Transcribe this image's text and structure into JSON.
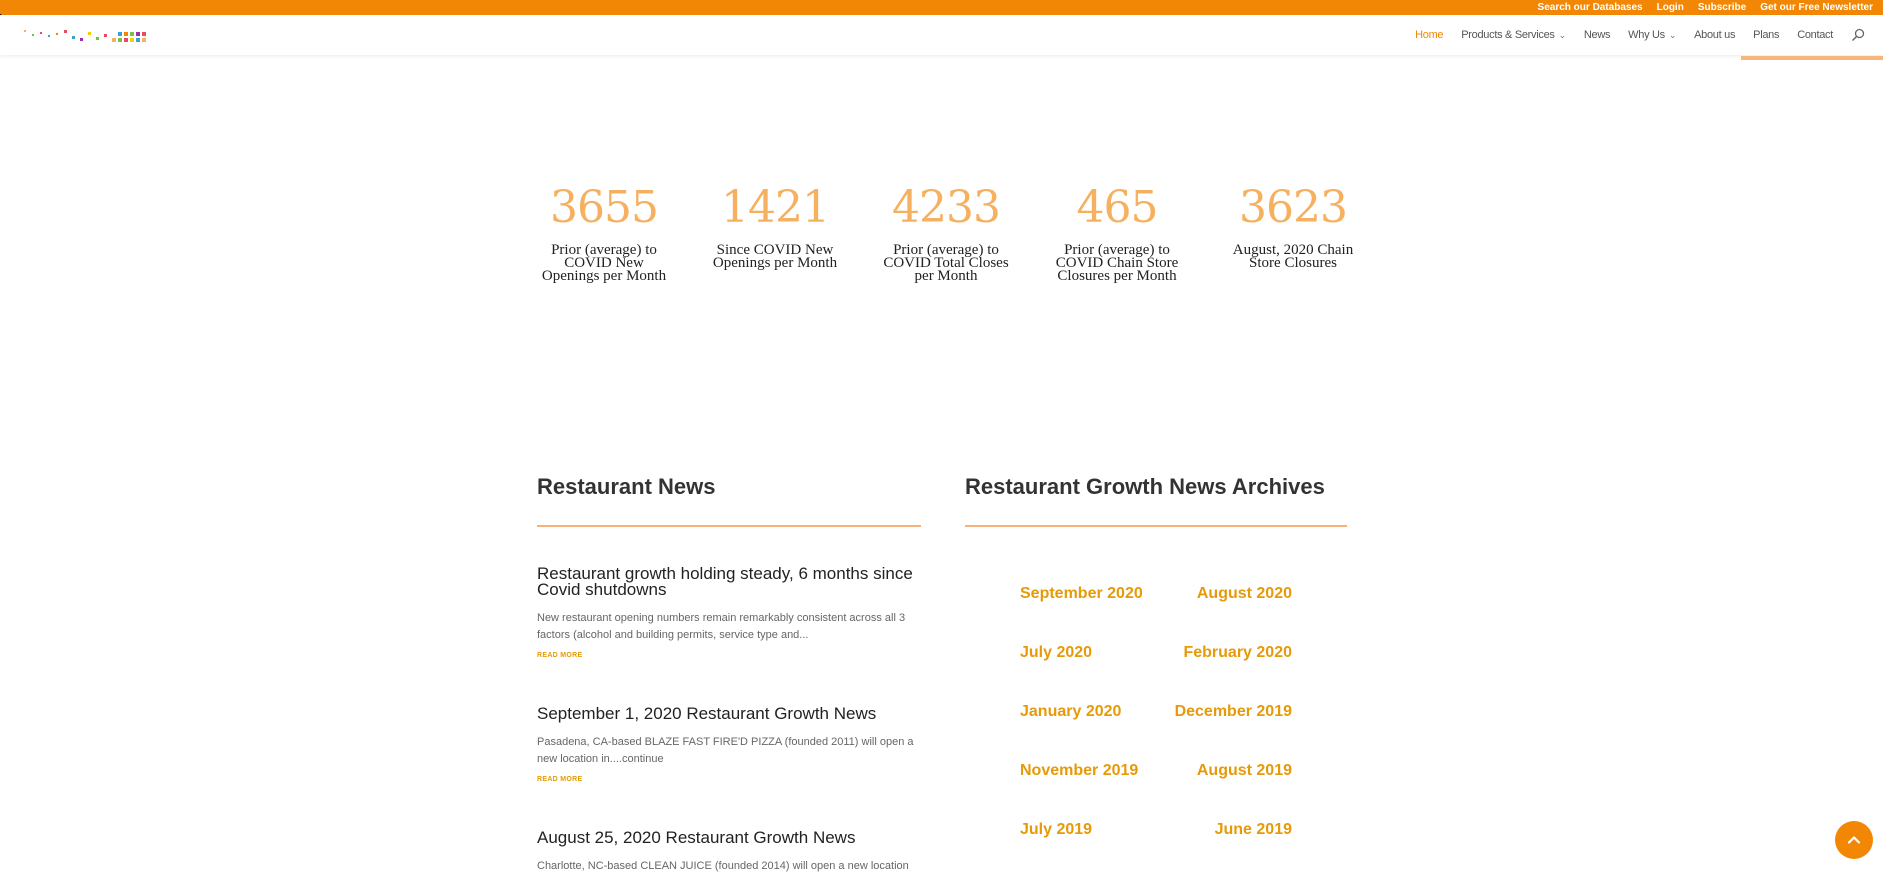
{
  "topbar": {
    "links": [
      "Search our Databases",
      "Login",
      "Subscribe",
      "Get our Free Newsletter"
    ]
  },
  "nav": {
    "home": "Home",
    "products": "Products & Services",
    "news": "News",
    "why_us": "Why Us",
    "about": "About us",
    "plans": "Plans",
    "contact": "Contact",
    "search_icon": "search-icon"
  },
  "stats": [
    {
      "number": "3655",
      "label": "Prior (average) to COVID New Openings per Month"
    },
    {
      "number": "1421",
      "label": "Since COVID New Openings per Month"
    },
    {
      "number": "4233",
      "label": "Prior (average) to COVID Total Closes per Month"
    },
    {
      "number": "465",
      "label": "Prior (average) to COVID Chain Store Closures per Month"
    },
    {
      "number": "3623",
      "label": "August, 2020 Chain Store Closures"
    }
  ],
  "news": {
    "heading": "Restaurant News",
    "items": [
      {
        "title": "Restaurant growth holding steady, 6 months since Covid shutdowns",
        "excerpt": "New restaurant opening numbers remain remarkably consistent across all 3 factors (alcohol and building permits, service type and...",
        "more": "READ MORE"
      },
      {
        "title": "September 1, 2020 Restaurant Growth News",
        "excerpt": "Pasadena, CA-based BLAZE FAST FIRE'D PIZZA (founded 2011) will open a new location in....continue",
        "more": "READ MORE"
      },
      {
        "title": "August 25, 2020 Restaurant Growth News",
        "excerpt": "Charlotte, NC-based CLEAN JUICE (founded 2014) will open a new location"
      }
    ]
  },
  "archives": {
    "heading": "Restaurant Growth News Archives",
    "left": [
      "September 2020",
      "July 2020",
      "January 2020",
      "November 2019",
      "July 2019"
    ],
    "right": [
      "August 2020",
      "February 2020",
      "December 2019",
      "August 2019",
      "June 2019"
    ]
  },
  "colors": {
    "accent": "#f28705",
    "number": "#f5b060",
    "archive": "#e79a08"
  }
}
